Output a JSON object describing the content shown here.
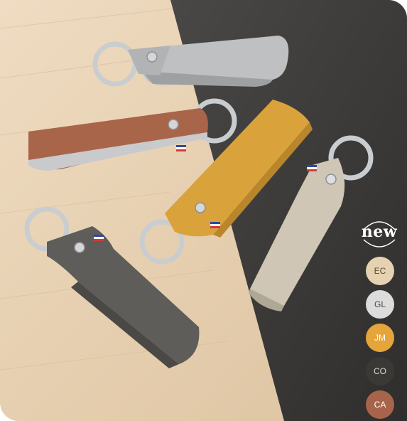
{
  "badge": {
    "new_label": "new"
  },
  "colors": [
    {
      "code": "EC",
      "hex": "#e6d2b0",
      "text_color": "#5a4a33"
    },
    {
      "code": "GL",
      "hex": "#dcdcdd",
      "text_color": "#4a4a4a"
    },
    {
      "code": "JM",
      "hex": "#e6a53a",
      "text_color": "#ffffff"
    },
    {
      "code": "CO",
      "hex": "#3b3936",
      "text_color": "#d9d9d9"
    },
    {
      "code": "CA",
      "hex": "#a8644a",
      "text_color": "#ffffff"
    }
  ],
  "palette": {
    "wood": "#e8d3b7",
    "slate": "#3f3d3b",
    "grey_leather": "#b9babb",
    "tan_leather": "#a8654a",
    "mustard_leather": "#d9a23a",
    "sand_leather": "#cfc6b6",
    "dark_leather": "#5e5d59",
    "metal": "#c9cdd0"
  }
}
